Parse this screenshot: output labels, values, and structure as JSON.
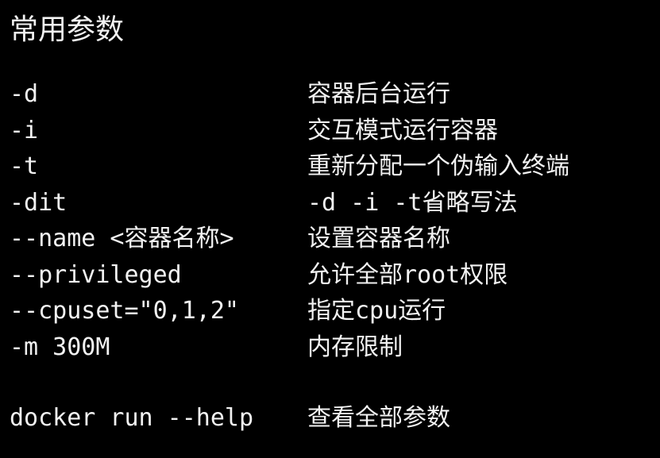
{
  "title": "常用参数",
  "options": [
    {
      "flag": "-d",
      "desc": "容器后台运行"
    },
    {
      "flag": "-i",
      "desc": "交互模式运行容器"
    },
    {
      "flag": "-t",
      "desc": "重新分配一个伪输入终端"
    },
    {
      "flag": "-dit",
      "desc": "-d -i -t省略写法"
    },
    {
      "flag": "--name <容器名称>",
      "desc": "设置容器名称"
    },
    {
      "flag": "--privileged",
      "desc": "允许全部root权限"
    },
    {
      "flag": "--cpuset=\"0,1,2\"",
      "desc": "指定cpu运行"
    },
    {
      "flag": "-m 300M",
      "desc": "内存限制"
    }
  ],
  "help": {
    "command": "docker run --help",
    "desc": "查看全部参数"
  }
}
